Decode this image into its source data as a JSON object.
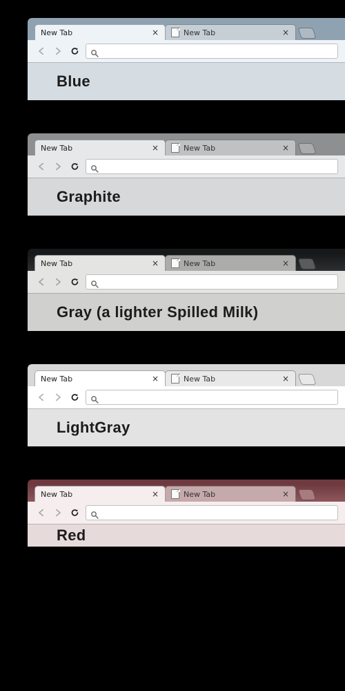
{
  "themes": [
    {
      "id": "blue",
      "label": "Blue",
      "frame": "#8fa2b2",
      "tabstrip": "#8fa2b2",
      "active_tab": "#eef3f8",
      "inactive_tab": "#c6cfd6",
      "newtab_chip": "#aeb9c3",
      "toolbar": "#eef3f8",
      "content": "#d6dde2",
      "tabs": [
        {
          "title": "New Tab",
          "active": true,
          "favicon": false
        },
        {
          "title": "New Tab",
          "active": false,
          "favicon": true
        }
      ]
    },
    {
      "id": "graphite",
      "label": "Graphite",
      "frame": "#8d8f91",
      "tabstrip": "#8d8f91",
      "active_tab": "#e7e8ea",
      "inactive_tab": "#bfc1c3",
      "newtab_chip": "#a9abad",
      "toolbar": "#e7e8ea",
      "content": "#d7d8d9",
      "tabs": [
        {
          "title": "New Tab",
          "active": true,
          "favicon": false
        },
        {
          "title": "New Tab",
          "active": false,
          "favicon": true
        }
      ]
    },
    {
      "id": "gray",
      "label": "Gray (a lighter Spilled Milk)",
      "frame": "#17181a",
      "tabstrip": "#2d2e30",
      "active_tab": "#e4e4e3",
      "inactive_tab": "#acadab",
      "newtab_chip": "#5a5b5c",
      "toolbar": "#e4e4e3",
      "content": "#d0d0cf",
      "tabs": [
        {
          "title": "New Tab",
          "active": true,
          "favicon": false
        },
        {
          "title": "New Tab",
          "active": false,
          "favicon": true
        }
      ]
    },
    {
      "id": "lightgray",
      "label": "LightGray",
      "frame": "#d7d8d7",
      "tabstrip": "#d7d8d7",
      "active_tab": "#ffffff",
      "inactive_tab": "#e8e9e8",
      "newtab_chip": "#e7e8e7",
      "toolbar": "#ffffff",
      "content": "#e2e3e2",
      "tabs": [
        {
          "title": "New Tab",
          "active": true,
          "favicon": false
        },
        {
          "title": "New Tab",
          "active": false,
          "favicon": true
        }
      ]
    },
    {
      "id": "red",
      "label": "Red",
      "frame": "#6e3a40",
      "tabstrip": "#8d575c",
      "active_tab": "#f6eeee",
      "inactive_tab": "#c6a9ab",
      "newtab_chip": "#a77b80",
      "toolbar": "#f6eeee",
      "content": "#e7dada",
      "tabs": [
        {
          "title": "New Tab",
          "active": true,
          "favicon": false
        },
        {
          "title": "New Tab",
          "active": false,
          "favicon": true
        }
      ]
    }
  ],
  "gaps": [
    26,
    48,
    48,
    48,
    48
  ],
  "last_block_content_height": 33,
  "icons": {
    "back": "back-icon",
    "forward": "forward-icon",
    "reload": "reload-icon",
    "search": "search-icon",
    "close": "close-icon",
    "page": "page-icon",
    "newtab": "new-tab-icon"
  },
  "omnibox_placeholder": ""
}
